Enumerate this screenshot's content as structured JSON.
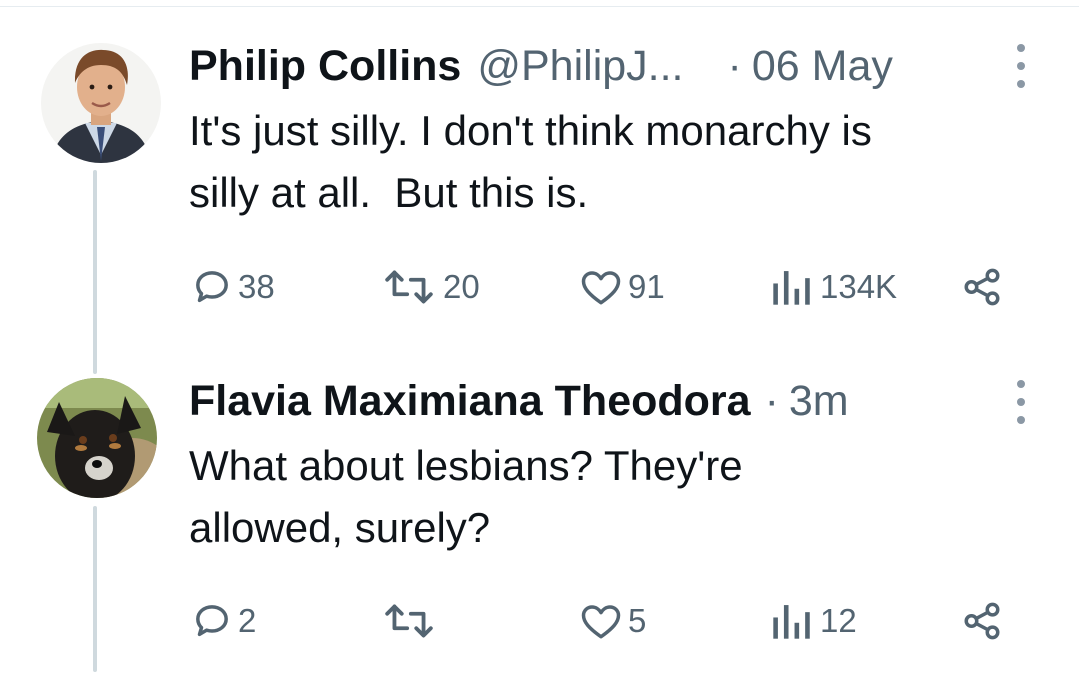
{
  "tweets": [
    {
      "author_name": "Philip Collins",
      "handle": "@PhilipJ...",
      "separator": "·",
      "time": "06 May",
      "text": "It's just silly. I don't think monarchy is\nsilly at all.  But this is.",
      "replies": "38",
      "retweets": "20",
      "likes": "91",
      "views": "134K",
      "avatar_icon": "person-photo-avatar"
    },
    {
      "author_name": "Flavia Maximiana Theodora",
      "separator": "·",
      "time": "3m",
      "text": "What about lesbians? They're\nallowed, surely?",
      "replies": "2",
      "retweets": "",
      "likes": "5",
      "views": "12",
      "avatar_icon": "dog-photo-avatar"
    }
  ],
  "icons": [
    "reply-icon",
    "retweet-icon",
    "like-icon",
    "views-icon",
    "share-icon",
    "more-icon"
  ],
  "colors": {
    "text": "#0f1419",
    "secondary": "#536471",
    "thread_line": "#cfd9de",
    "background": "#ffffff"
  }
}
